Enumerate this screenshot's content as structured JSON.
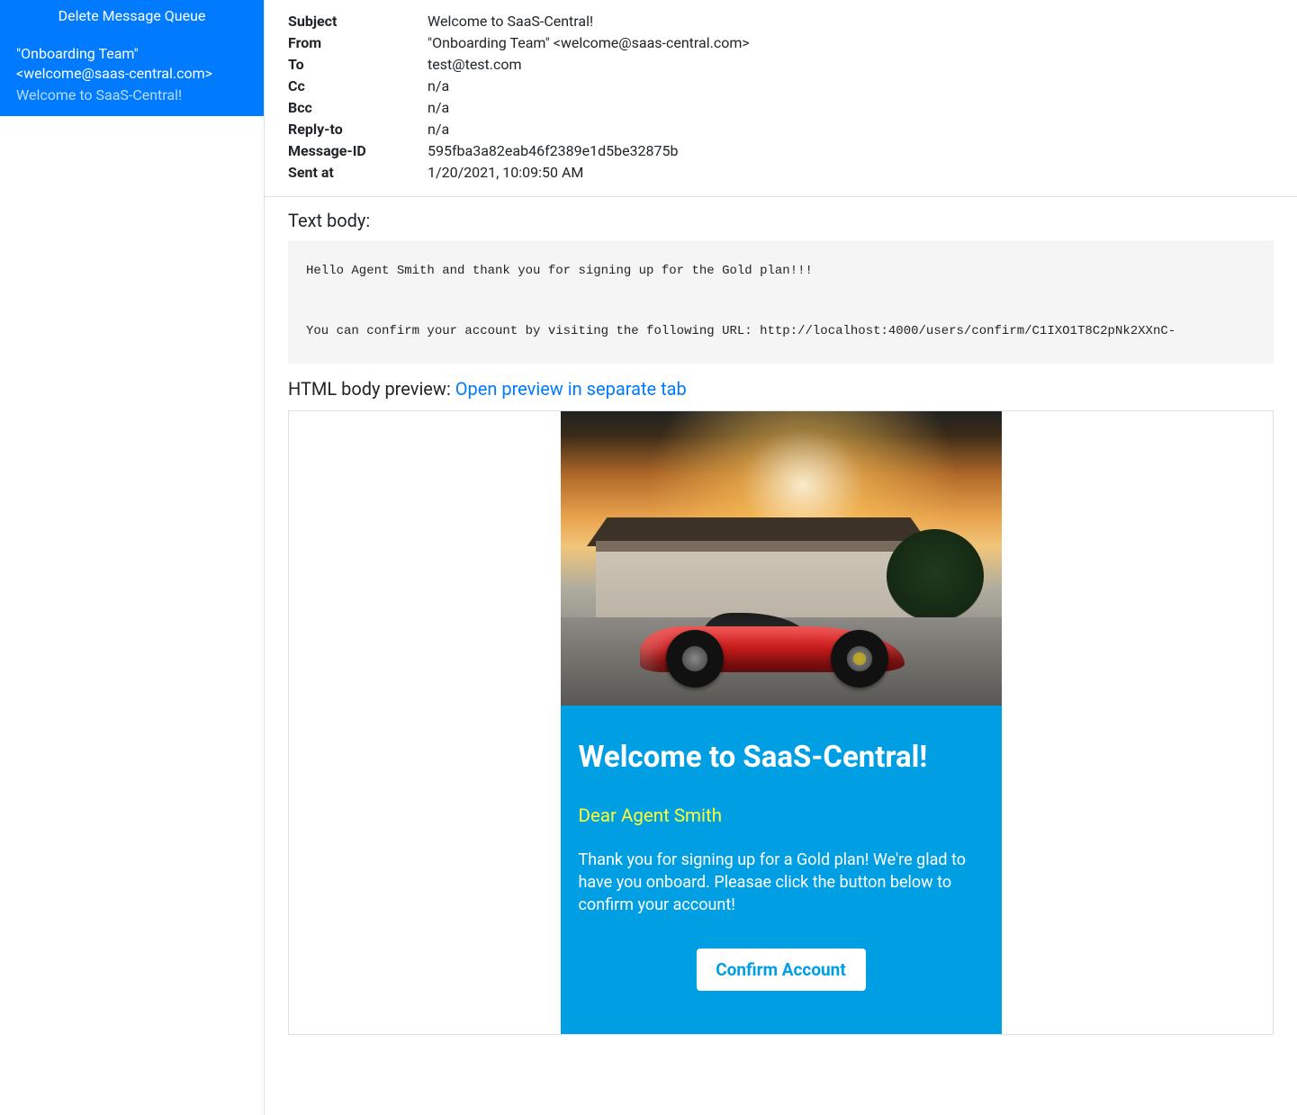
{
  "sidebar": {
    "delete_label": "Delete Message Queue",
    "messages": [
      {
        "from": "\"Onboarding Team\" <welcome@saas-central.com>",
        "subject": "Welcome to SaaS-Central!"
      }
    ]
  },
  "meta": {
    "labels": {
      "subject": "Subject",
      "from": "From",
      "to": "To",
      "cc": "Cc",
      "bcc": "Bcc",
      "reply_to": "Reply-to",
      "message_id": "Message-ID",
      "sent_at": "Sent at"
    },
    "subject": "Welcome to SaaS-Central!",
    "from": "\"Onboarding Team\" <welcome@saas-central.com>",
    "to": "test@test.com",
    "cc": "n/a",
    "bcc": "n/a",
    "reply_to": "n/a",
    "message_id": "595fba3a82eab46f2389e1d5be32875b",
    "sent_at": "1/20/2021, 10:09:50 AM"
  },
  "text_body": {
    "heading": "Text body:",
    "content": "Hello Agent Smith and thank you for signing up for the Gold plan!!!\n\nYou can confirm your account by visiting the following URL: http://localhost:4000/users/confirm/C1IXO1T8C2pNk2XXnC-"
  },
  "html_body": {
    "heading": "HTML body preview: ",
    "link_text": "Open preview in separate tab"
  },
  "email": {
    "title": "Welcome to SaaS-Central!",
    "greeting": "Dear Agent Smith",
    "paragraph": "Thank you for signing up for a Gold plan! We're glad to have you onboard. Pleasae click the button below to confirm your account!",
    "confirm_label": "Confirm Account"
  }
}
